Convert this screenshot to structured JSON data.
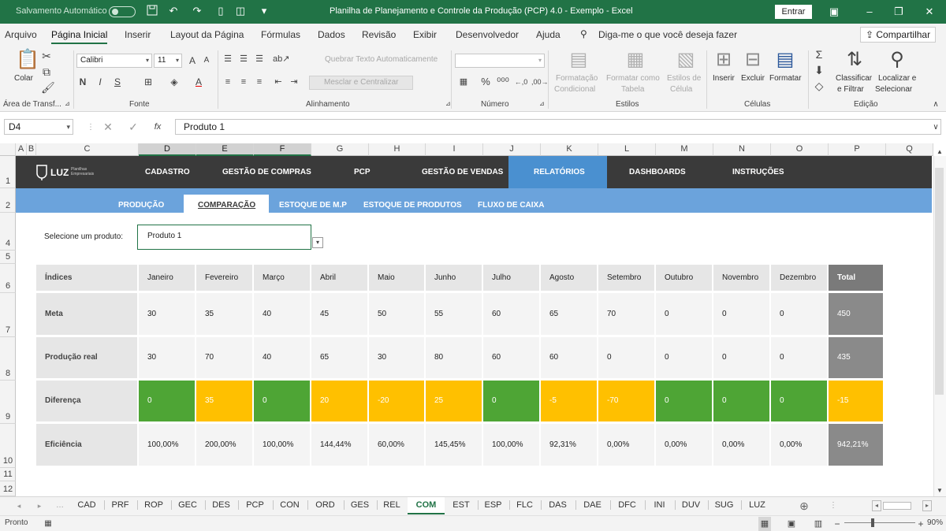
{
  "titlebar": {
    "autosave_label": "Salvamento Automático",
    "doc_title": "Planilha de Planejamento e Controle da Produção (PCP) 4.0 - Exemplo  -  Excel",
    "signin_label": "Entrar"
  },
  "menu": {
    "tabs": [
      "Arquivo",
      "Página Inicial",
      "Inserir",
      "Layout da Página",
      "Fórmulas",
      "Dados",
      "Revisão",
      "Exibir",
      "Desenvolvedor",
      "Ajuda"
    ],
    "tell_me": "Diga-me o que você deseja fazer",
    "share": "Compartilhar"
  },
  "ribbon": {
    "paste_label": "Colar",
    "clipboard_group": "Área de Transf...",
    "font_name": "Calibri",
    "font_size": "11",
    "font_group": "Fonte",
    "wrap_text": "Quebrar Texto Automaticamente",
    "merge_center": "Mesclar e Centralizar",
    "alignment_group": "Alinhamento",
    "number_group": "Número",
    "cond_format": [
      "Formatação",
      "Condicional"
    ],
    "format_table": [
      "Formatar como",
      "Tabela"
    ],
    "cell_styles": [
      "Estilos de",
      "Célula"
    ],
    "styles_group": "Estilos",
    "insert_label": "Inserir",
    "delete_label": "Excluir",
    "format_label": "Formatar",
    "cells_group": "Células",
    "sort_filter": [
      "Classificar",
      "e Filtrar"
    ],
    "find_select": [
      "Localizar e",
      "Selecionar"
    ],
    "edit_group": "Edição"
  },
  "formula_bar": {
    "name_box": "D4",
    "fx": "fx",
    "content": "Produto 1"
  },
  "columns": [
    "A",
    "B",
    "C",
    "D",
    "E",
    "F",
    "G",
    "H",
    "I",
    "J",
    "K",
    "L",
    "M",
    "N",
    "O",
    "P",
    "Q"
  ],
  "rows": [
    "1",
    "2",
    "4",
    "5",
    "6",
    "7",
    "8",
    "9",
    "10",
    "11",
    "12"
  ],
  "dashboard_nav": {
    "logo": "LUZ",
    "logo_sub": "Planilhas Empresariais",
    "items": [
      "CADASTRO",
      "GESTÃO DE COMPRAS",
      "PCP",
      "GESTÃO DE VENDAS",
      "RELATÓRIOS",
      "DASHBOARDS",
      "INSTRUÇÕES"
    ],
    "active": "RELATÓRIOS"
  },
  "sub_nav": {
    "items": [
      "PRODUÇÃO",
      "COMPARAÇÃO",
      "ESTOQUE DE M.P",
      "ESTOQUE DE PRODUTOS",
      "FLUXO DE CAIXA"
    ],
    "active": "COMPARAÇÃO"
  },
  "selector": {
    "label": "Selecione um produto:",
    "value": "Produto 1"
  },
  "table": {
    "headers": [
      "Índices",
      "Janeiro",
      "Fevereiro",
      "Março",
      "Abril",
      "Maio",
      "Junho",
      "Julho",
      "Agosto",
      "Setembro",
      "Outubro",
      "Novembro",
      "Dezembro",
      "Total"
    ],
    "rows": [
      {
        "label": "Meta",
        "values": [
          "30",
          "35",
          "40",
          "45",
          "50",
          "55",
          "60",
          "65",
          "70",
          "0",
          "0",
          "0"
        ],
        "total": "450"
      },
      {
        "label": "Produção real",
        "values": [
          "30",
          "70",
          "40",
          "65",
          "30",
          "80",
          "60",
          "60",
          "0",
          "0",
          "0",
          "0"
        ],
        "total": "435"
      },
      {
        "label": "Diferença",
        "values": [
          "0",
          "35",
          "0",
          "20",
          "-20",
          "25",
          "0",
          "-5",
          "-70",
          "0",
          "0",
          "0"
        ],
        "total": "-15"
      },
      {
        "label": "Eficiência",
        "values": [
          "100,00%",
          "200,00%",
          "100,00%",
          "144,44%",
          "60,00%",
          "145,45%",
          "100,00%",
          "92,31%",
          "0,00%",
          "0,00%",
          "0,00%",
          "0,00%"
        ],
        "total": "942,21%"
      }
    ],
    "diff_status": [
      "green",
      "yellow",
      "green",
      "yellow",
      "yellow",
      "yellow",
      "green",
      "yellow",
      "yellow",
      "green",
      "green",
      "green",
      "yellow"
    ],
    "colors": {
      "green": "#4ea535",
      "yellow": "#ffc000",
      "total": "#8a8a8a"
    }
  },
  "sheets": {
    "tabs": [
      "CAD",
      "PRF",
      "ROP",
      "GEC",
      "DES",
      "PCP",
      "CON",
      "ORD",
      "GES",
      "REL",
      "COM",
      "EST",
      "ESP",
      "FLC",
      "DAS",
      "DAE",
      "DFC",
      "INI",
      "DUV",
      "SUG",
      "LUZ"
    ],
    "active": "COM"
  },
  "status": {
    "ready": "Pronto",
    "zoom": "90%"
  },
  "accent": "#217346"
}
